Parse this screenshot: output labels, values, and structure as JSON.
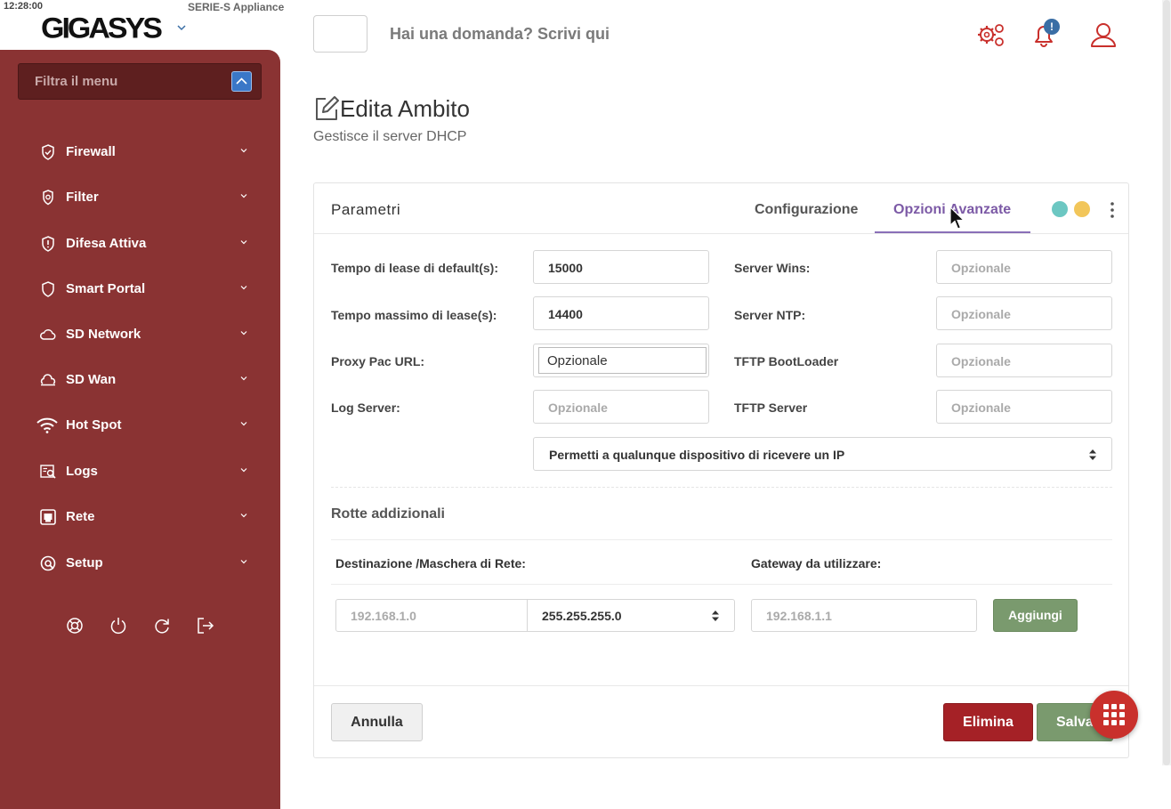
{
  "status": {
    "time": "12:28:00",
    "appliance": "SERIE-S Appliance"
  },
  "brand": {
    "logo": "GIGASYS"
  },
  "header": {
    "search_hint": "Hai una domanda? Scrivi qui",
    "notification_count": "!"
  },
  "sidebar": {
    "filter_placeholder": "Filtra il menu",
    "items": [
      {
        "label": "Firewall",
        "icon": "shield-check-icon"
      },
      {
        "label": "Filter",
        "icon": "filter-gear-icon"
      },
      {
        "label": "Difesa Attiva",
        "icon": "shield-alert-icon"
      },
      {
        "label": "Smart Portal",
        "icon": "shield-icon"
      },
      {
        "label": "SD Network",
        "icon": "cloud-icon"
      },
      {
        "label": "SD Wan",
        "icon": "cloud-wan-icon"
      },
      {
        "label": "Hot Spot",
        "icon": "wifi-icon"
      },
      {
        "label": "Logs",
        "icon": "logs-search-icon"
      },
      {
        "label": "Rete",
        "icon": "ethernet-icon"
      },
      {
        "label": "Setup",
        "icon": "setup-icon"
      }
    ],
    "bottom_icons": [
      "lifebuoy-icon",
      "power-icon",
      "refresh-icon",
      "logout-icon"
    ]
  },
  "page": {
    "title": "Edita Ambito",
    "subtitle": "Gestisce il server DHCP"
  },
  "card": {
    "title": "Parametri",
    "tabs": [
      {
        "label": "Configurazione",
        "active": false
      },
      {
        "label": "Opzioni Avanzate",
        "active": true
      }
    ],
    "status_dots": [
      "#6cc7c2",
      "#f2c65a"
    ]
  },
  "form": {
    "lease_default": {
      "label": "Tempo di lease di default(s):",
      "value": "15000"
    },
    "lease_max": {
      "label": "Tempo massimo di lease(s):",
      "value": "14400"
    },
    "proxy_pac": {
      "label": "Proxy Pac URL:",
      "placeholder": "Opzionale"
    },
    "log_server": {
      "label": "Log Server:",
      "placeholder": "Opzionale"
    },
    "server_wins": {
      "label": "Server Wins:",
      "placeholder": "Opzionale"
    },
    "server_ntp": {
      "label": "Server NTP:",
      "placeholder": "Opzionale"
    },
    "tftp_bootloader": {
      "label": "TFTP BootLoader",
      "placeholder": "Opzionale"
    },
    "tftp_server": {
      "label": "TFTP Server",
      "placeholder": "Opzionale"
    },
    "allow_select": "Permetti a qualunque dispositivo di ricevere un IP"
  },
  "routes": {
    "title": "Rotte addizionali",
    "col_destination": "Destinazione /Maschera di Rete:",
    "col_gateway": "Gateway da utilizzare:",
    "dest_placeholder": "192.168.1.0",
    "mask_value": "255.255.255.0",
    "gateway_placeholder": "192.168.1.1",
    "add_label": "Aggiungi"
  },
  "footer": {
    "cancel_label": "Annulla",
    "delete_label": "Elimina",
    "save_label": "Salva"
  },
  "colors": {
    "sidebar": "#8a3333",
    "accent_tab": "#7c5aa6",
    "delete": "#a52126",
    "save": "#7a9a6e",
    "fab": "#c9302c"
  }
}
